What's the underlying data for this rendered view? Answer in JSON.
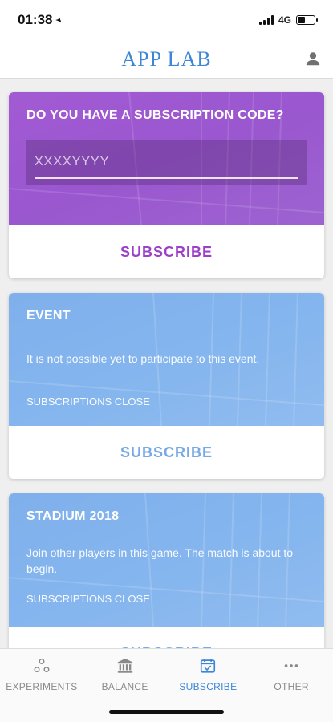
{
  "status_bar": {
    "time": "01:38",
    "network": "4G",
    "battery_level": 0.45
  },
  "header": {
    "title": "APP LAB"
  },
  "cards": {
    "subscription": {
      "title": "DO YOU HAVE A SUBSCRIPTION CODE?",
      "placeholder": "XXXXYYYY",
      "button": "SUBSCRIBE",
      "color": "#a25ad3",
      "button_color": "#9b40c9"
    },
    "event": {
      "title": "EVENT",
      "description": "It is not possible yet to participate to this event.",
      "status": "SUBSCRIPTIONS CLOSE",
      "button": "SUBSCRIBE",
      "color": "#85b4ee",
      "button_color": "#78a9e6"
    },
    "stadium": {
      "title": "STADIUM 2018",
      "description": "Join other players in this game. The match is about to begin.",
      "status": "SUBSCRIPTIONS CLOSE",
      "button": "SUBSCRIBE",
      "color": "#85b4ee",
      "button_color": "#78a9e6"
    }
  },
  "tabs": [
    {
      "label": "EXPERIMENTS",
      "icon": "experiments-icon",
      "active": false
    },
    {
      "label": "BALANCE",
      "icon": "bank-icon",
      "active": false
    },
    {
      "label": "SUBSCRIBE",
      "icon": "calendar-check-icon",
      "active": true
    },
    {
      "label": "OTHER",
      "icon": "more-icon",
      "active": false
    }
  ],
  "colors": {
    "accent": "#3b86d6",
    "inactive": "#8a8a8a"
  }
}
